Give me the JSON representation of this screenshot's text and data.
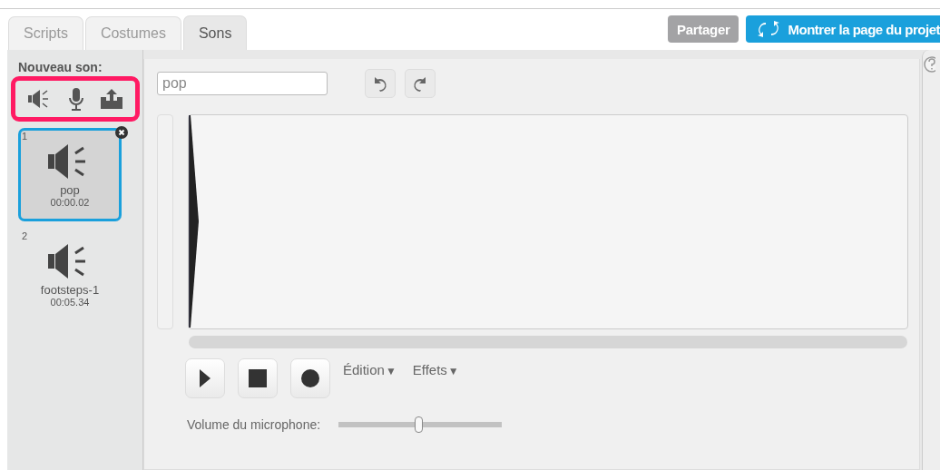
{
  "tabs": [
    {
      "label": "Scripts",
      "selected": false
    },
    {
      "label": "Costumes",
      "selected": false
    },
    {
      "label": "Sons",
      "selected": true
    }
  ],
  "header_buttons": {
    "share": "Partager",
    "project_page": "Montrer la page du projet"
  },
  "new_sound": {
    "label": "Nouveau son:",
    "highlighted": true
  },
  "sounds": [
    {
      "index": "1",
      "name": "pop",
      "duration": "00:00.02",
      "selected": true
    },
    {
      "index": "2",
      "name": "footsteps-1",
      "duration": "00:05.34",
      "selected": false
    }
  ],
  "editor": {
    "name_value": "pop",
    "menus": [
      {
        "label": "Édition",
        "caret": "▼"
      },
      {
        "label": "Effets",
        "caret": "▼"
      }
    ],
    "mic_volume": {
      "label": "Volume du microphone:",
      "level": 0.49
    }
  }
}
